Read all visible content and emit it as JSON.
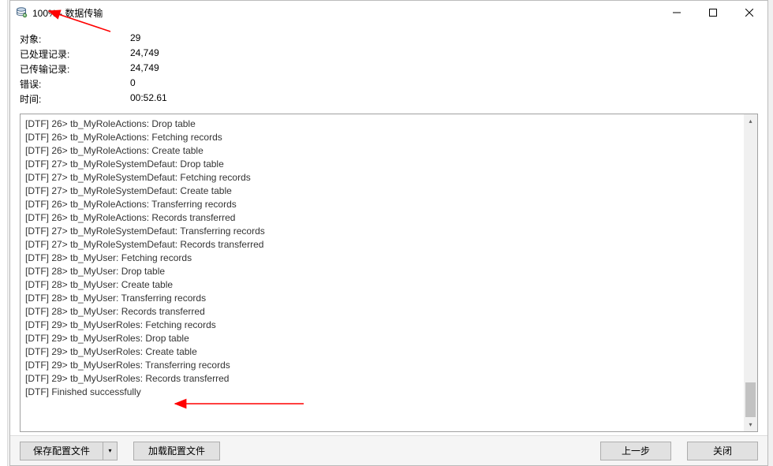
{
  "window": {
    "title": "100% - 数据传输"
  },
  "stats": {
    "objects_label": "对象:",
    "objects_value": "29",
    "processed_label": "已处理记录:",
    "processed_value": "24,749",
    "transferred_label": "已传输记录:",
    "transferred_value": "24,749",
    "errors_label": "错误:",
    "errors_value": "0",
    "time_label": "时间:",
    "time_value": "00:52.61"
  },
  "log": {
    "lines": [
      "[DTF] 26> tb_MyRoleActions: Drop table",
      "[DTF] 26> tb_MyRoleActions: Fetching records",
      "[DTF] 26> tb_MyRoleActions: Create table",
      "[DTF] 27> tb_MyRoleSystemDefaut: Drop table",
      "[DTF] 27> tb_MyRoleSystemDefaut: Fetching records",
      "[DTF] 27> tb_MyRoleSystemDefaut: Create table",
      "[DTF] 26> tb_MyRoleActions: Transferring records",
      "[DTF] 26> tb_MyRoleActions: Records transferred",
      "[DTF] 27> tb_MyRoleSystemDefaut: Transferring records",
      "[DTF] 27> tb_MyRoleSystemDefaut: Records transferred",
      "[DTF] 28> tb_MyUser: Fetching records",
      "[DTF] 28> tb_MyUser: Drop table",
      "[DTF] 28> tb_MyUser: Create table",
      "[DTF] 28> tb_MyUser: Transferring records",
      "[DTF] 28> tb_MyUser: Records transferred",
      "[DTF] 29> tb_MyUserRoles: Fetching records",
      "[DTF] 29> tb_MyUserRoles: Drop table",
      "[DTF] 29> tb_MyUserRoles: Create table",
      "[DTF] 29> tb_MyUserRoles: Transferring records",
      "[DTF] 29> tb_MyUserRoles: Records transferred",
      "[DTF] Finished successfully"
    ]
  },
  "buttons": {
    "save_profile": "保存配置文件",
    "load_profile": "加载配置文件",
    "prev_step": "上一步",
    "close": "关闭"
  }
}
